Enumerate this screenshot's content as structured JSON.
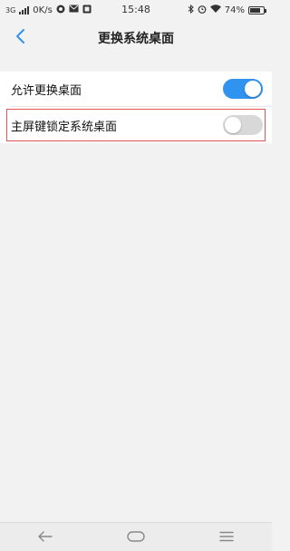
{
  "status_bar": {
    "network": "3G",
    "speed": "0K/s",
    "time": "15:48",
    "battery_text": "74%",
    "battery_level": 0.74,
    "icons": [
      "signal-icon",
      "app-notification-icon",
      "mail-icon",
      "image-icon",
      "bluetooth-icon",
      "alarm-icon",
      "wifi-icon",
      "battery-icon"
    ]
  },
  "header": {
    "title": "更换系统桌面",
    "back_icon": "chevron-left-icon"
  },
  "settings": [
    {
      "label": "允许更换桌面",
      "toggle": "on"
    },
    {
      "label": "主屏键锁定系统桌面",
      "toggle": "off",
      "highlighted": true
    }
  ],
  "colors": {
    "accent": "#2f93ef",
    "highlight_border": "#e05555",
    "background": "#f2f2f2"
  },
  "nav_bar": {
    "icons": [
      "back-arrow-icon",
      "home-icon",
      "menu-icon"
    ]
  }
}
